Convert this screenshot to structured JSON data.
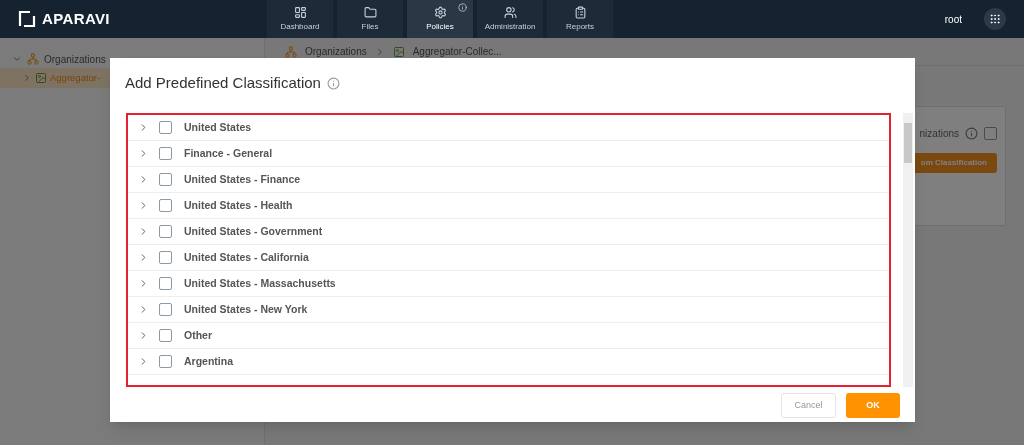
{
  "header": {
    "logo": "APARAVI",
    "nav": [
      {
        "label": "Dashboard",
        "kind": "dashboard",
        "selected": false,
        "info": false
      },
      {
        "label": "Files",
        "kind": "files",
        "selected": false,
        "info": false
      },
      {
        "label": "Policies",
        "kind": "policies",
        "selected": true,
        "info": true
      },
      {
        "label": "Administration",
        "kind": "administration",
        "selected": false,
        "info": false
      },
      {
        "label": "Reports",
        "kind": "reports",
        "selected": false,
        "info": false
      }
    ],
    "user": "root"
  },
  "sidebar": {
    "tree": [
      {
        "label": "Organizations",
        "expanded": true,
        "selected": false,
        "children": [
          {
            "label": "Aggregator-",
            "expanded": false,
            "selected": true
          }
        ]
      }
    ]
  },
  "breadcrumb": [
    "Organizations",
    "Aggregator-Collec..."
  ],
  "panel": {
    "title": "nizations",
    "checked": false,
    "button": "om Classification"
  },
  "dialog": {
    "title": "Add Predefined Classification",
    "items": [
      {
        "label": "United States",
        "checked": false,
        "expanded": false
      },
      {
        "label": "Finance - General",
        "checked": false,
        "expanded": false
      },
      {
        "label": "United States - Finance",
        "checked": false,
        "expanded": false
      },
      {
        "label": "United States - Health",
        "checked": false,
        "expanded": false
      },
      {
        "label": "United States - Government",
        "checked": false,
        "expanded": false
      },
      {
        "label": "United States - California",
        "checked": false,
        "expanded": false
      },
      {
        "label": "United States - Massachusetts",
        "checked": false,
        "expanded": false
      },
      {
        "label": "United States - New York",
        "checked": false,
        "expanded": false
      },
      {
        "label": "Other",
        "checked": false,
        "expanded": false
      },
      {
        "label": "Argentina",
        "checked": false,
        "expanded": false
      }
    ],
    "buttons": [
      {
        "label": "Cancel",
        "kind": "secondary"
      },
      {
        "label": "OK",
        "kind": "primary"
      }
    ]
  }
}
